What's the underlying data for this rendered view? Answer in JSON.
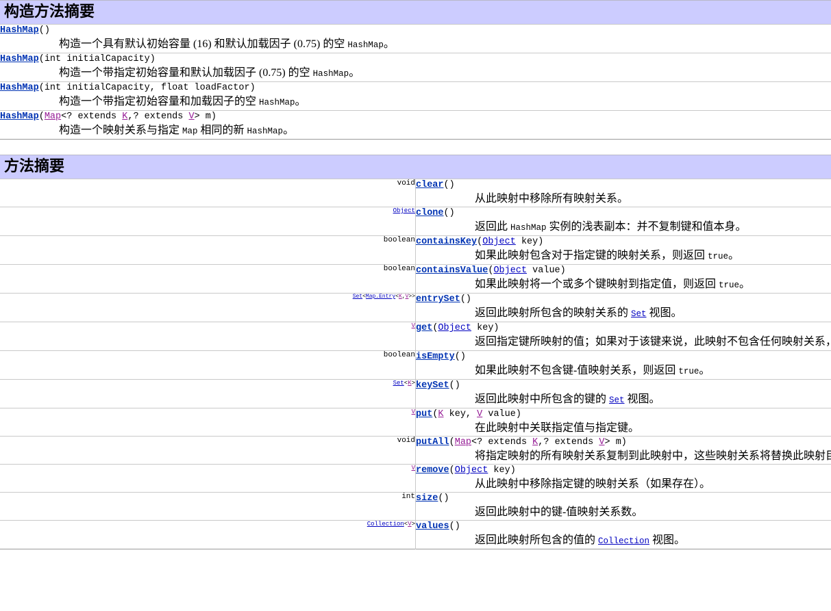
{
  "colors": {
    "banner_bg": "#CCCCFF",
    "link_blue": "#0000C0",
    "link_purple": "#951B95",
    "method_name": "#0033B3",
    "border_gray": "#C9C9C9",
    "text": "#000000"
  },
  "constructor_section": {
    "title": "构造方法摘要",
    "rows": [
      {
        "name": "HashMap",
        "signature_parts": [
          {
            "text": "HashMap",
            "kind": "method-link"
          },
          {
            "text": "()",
            "kind": "plain"
          }
        ],
        "signature_text": "HashMap()",
        "description_parts": [
          {
            "text": "构造一个具有默认初始容量 (16) 和默认加载因子 (0.75) 的空 ",
            "kind": "text"
          },
          {
            "text": "HashMap",
            "kind": "code"
          },
          {
            "text": "。",
            "kind": "text"
          }
        ],
        "description_text": "构造一个具有默认初始容量 (16) 和默认加载因子 (0.75) 的空 HashMap。"
      },
      {
        "name": "HashMap(int initialCapacity)",
        "signature_parts": [
          {
            "text": "HashMap",
            "kind": "method-link"
          },
          {
            "text": "(int initialCapacity)",
            "kind": "plain"
          }
        ],
        "signature_text": "HashMap(int initialCapacity)",
        "description_parts": [
          {
            "text": "构造一个带指定初始容量和默认加载因子 (0.75) 的空 ",
            "kind": "text"
          },
          {
            "text": "HashMap",
            "kind": "code"
          },
          {
            "text": "。",
            "kind": "text"
          }
        ],
        "description_text": "构造一个带指定初始容量和默认加载因子 (0.75) 的空 HashMap。"
      },
      {
        "name": "HashMap(int initialCapacity, float loadFactor)",
        "signature_parts": [
          {
            "text": "HashMap",
            "kind": "method-link"
          },
          {
            "text": "(int initialCapacity, float loadFactor)",
            "kind": "plain"
          }
        ],
        "signature_text": "HashMap(int initialCapacity, float loadFactor)",
        "description_parts": [
          {
            "text": "构造一个带指定初始容量和加载因子的空 ",
            "kind": "text"
          },
          {
            "text": "HashMap",
            "kind": "code"
          },
          {
            "text": "。",
            "kind": "text"
          }
        ],
        "description_text": "构造一个带指定初始容量和加载因子的空 HashMap。"
      },
      {
        "name": "HashMap(Map<? extends K,? extends V> m)",
        "signature_parts": [
          {
            "text": "HashMap",
            "kind": "method-link"
          },
          {
            "text": "(",
            "kind": "plain"
          },
          {
            "text": "Map",
            "kind": "type-link-purple"
          },
          {
            "text": "<? extends ",
            "kind": "plain"
          },
          {
            "text": "K",
            "kind": "type-link-purple"
          },
          {
            "text": ",? extends ",
            "kind": "plain"
          },
          {
            "text": "V",
            "kind": "type-link-purple"
          },
          {
            "text": "> m)",
            "kind": "plain"
          }
        ],
        "signature_text": "HashMap(Map<? extends K,? extends V> m)",
        "description_parts": [
          {
            "text": "构造一个映射关系与指定 ",
            "kind": "text"
          },
          {
            "text": "Map",
            "kind": "code"
          },
          {
            "text": " 相同的新 ",
            "kind": "text"
          },
          {
            "text": "HashMap",
            "kind": "code"
          },
          {
            "text": "。",
            "kind": "text"
          }
        ],
        "description_text": "构造一个映射关系与指定 Map 相同的新 HashMap。"
      }
    ]
  },
  "method_section": {
    "title": "方法摘要",
    "rows": [
      {
        "return_type_text": "void",
        "return_type_parts": [
          {
            "text": "void",
            "kind": "plain"
          }
        ],
        "return_size": "normal",
        "name": "clear",
        "signature_parts": [
          {
            "text": "clear",
            "kind": "method-link"
          },
          {
            "text": "()",
            "kind": "plain"
          }
        ],
        "signature_text": "clear()",
        "description_parts": [
          {
            "text": "从此映射中移除所有映射关系。",
            "kind": "text"
          }
        ],
        "description_text": "从此映射中移除所有映射关系。"
      },
      {
        "return_type_text": "Object",
        "return_type_parts": [
          {
            "text": "Object",
            "kind": "type-link"
          }
        ],
        "return_size": "tiny",
        "name": "clone",
        "signature_parts": [
          {
            "text": "clone",
            "kind": "method-link"
          },
          {
            "text": "()",
            "kind": "plain"
          }
        ],
        "signature_text": "clone()",
        "description_parts": [
          {
            "text": "返回此 ",
            "kind": "text"
          },
          {
            "text": "HashMap",
            "kind": "code"
          },
          {
            "text": " 实例的浅表副本：并不复制键和值本身。",
            "kind": "text"
          }
        ],
        "description_text": "返回此 HashMap 实例的浅表副本：并不复制键和值本身。"
      },
      {
        "return_type_text": "boolean",
        "return_type_parts": [
          {
            "text": "boolean",
            "kind": "plain"
          }
        ],
        "return_size": "normal",
        "name": "containsKey",
        "signature_parts": [
          {
            "text": "containsKey",
            "kind": "method-link"
          },
          {
            "text": "(",
            "kind": "plain"
          },
          {
            "text": "Object",
            "kind": "type-link"
          },
          {
            "text": " key)",
            "kind": "plain"
          }
        ],
        "signature_text": "containsKey(Object key)",
        "description_parts": [
          {
            "text": "如果此映射包含对于指定键的映射关系，则返回 ",
            "kind": "text"
          },
          {
            "text": "true",
            "kind": "code"
          },
          {
            "text": "。",
            "kind": "text"
          }
        ],
        "description_text": "如果此映射包含对于指定键的映射关系，则返回 true。"
      },
      {
        "return_type_text": "boolean",
        "return_type_parts": [
          {
            "text": "boolean",
            "kind": "plain"
          }
        ],
        "return_size": "normal",
        "name": "containsValue",
        "signature_parts": [
          {
            "text": "containsValue",
            "kind": "method-link"
          },
          {
            "text": "(",
            "kind": "plain"
          },
          {
            "text": "Object",
            "kind": "type-link"
          },
          {
            "text": " value)",
            "kind": "plain"
          }
        ],
        "signature_text": "containsValue(Object value)",
        "description_parts": [
          {
            "text": "如果此映射将一个或多个键映射到指定值，则返回 ",
            "kind": "text"
          },
          {
            "text": "true",
            "kind": "code"
          },
          {
            "text": "。",
            "kind": "text"
          }
        ],
        "description_text": "如果此映射将一个或多个键映射到指定值，则返回 true。"
      },
      {
        "return_type_text": "Set<Map.Entry<K,V>>",
        "return_type_parts": [
          {
            "text": "Set",
            "kind": "type-link"
          },
          {
            "text": "<",
            "kind": "plain"
          },
          {
            "text": "Map.Entry",
            "kind": "type-link"
          },
          {
            "text": "<",
            "kind": "plain"
          },
          {
            "text": "K",
            "kind": "type-link-purple"
          },
          {
            "text": ",",
            "kind": "plain"
          },
          {
            "text": "V",
            "kind": "type-link-purple"
          },
          {
            "text": ">>",
            "kind": "plain"
          }
        ],
        "return_size": "xtiny",
        "name": "entrySet",
        "signature_parts": [
          {
            "text": "entrySet",
            "kind": "method-link"
          },
          {
            "text": "()",
            "kind": "plain"
          }
        ],
        "signature_text": "entrySet()",
        "description_parts": [
          {
            "text": "返回此映射所包含的映射关系的 ",
            "kind": "text"
          },
          {
            "text": "Set",
            "kind": "code-link"
          },
          {
            "text": " 视图。",
            "kind": "text"
          }
        ],
        "description_text": "返回此映射所包含的映射关系的 Set 视图。"
      },
      {
        "return_type_text": "V",
        "return_type_parts": [
          {
            "text": "V",
            "kind": "type-link-purple"
          }
        ],
        "return_size": "tiny",
        "name": "get",
        "signature_parts": [
          {
            "text": "get",
            "kind": "method-link"
          },
          {
            "text": "(",
            "kind": "plain"
          },
          {
            "text": "Object",
            "kind": "type-link"
          },
          {
            "text": " key)",
            "kind": "plain"
          }
        ],
        "signature_text": "get(Object key)",
        "description_parts": [
          {
            "text": "返回指定键所映射的值；如果对于该键来说，此映射不包含任何映射关系，则返回 ",
            "kind": "text"
          },
          {
            "text": "null",
            "kind": "code"
          },
          {
            "text": "。",
            "kind": "text"
          }
        ],
        "description_text": "返回指定键所映射的值；如果对于该键来说，此映射不包含任何映射关系，则返回 null。"
      },
      {
        "return_type_text": "boolean",
        "return_type_parts": [
          {
            "text": "boolean",
            "kind": "plain"
          }
        ],
        "return_size": "normal",
        "name": "isEmpty",
        "signature_parts": [
          {
            "text": "isEmpty",
            "kind": "method-link"
          },
          {
            "text": "()",
            "kind": "plain"
          }
        ],
        "signature_text": "isEmpty()",
        "description_parts": [
          {
            "text": "如果此映射不包含键-值映射关系，则返回 ",
            "kind": "text"
          },
          {
            "text": "true",
            "kind": "code"
          },
          {
            "text": "。",
            "kind": "text"
          }
        ],
        "description_text": "如果此映射不包含键-值映射关系，则返回 true。"
      },
      {
        "return_type_text": "Set<K>",
        "return_type_parts": [
          {
            "text": "Set",
            "kind": "type-link"
          },
          {
            "text": "<",
            "kind": "plain"
          },
          {
            "text": "K",
            "kind": "type-link-purple"
          },
          {
            "text": ">",
            "kind": "plain"
          }
        ],
        "return_size": "tiny",
        "name": "keySet",
        "signature_parts": [
          {
            "text": "keySet",
            "kind": "method-link"
          },
          {
            "text": "()",
            "kind": "plain"
          }
        ],
        "signature_text": "keySet()",
        "description_parts": [
          {
            "text": "返回此映射中所包含的键的 ",
            "kind": "text"
          },
          {
            "text": "Set",
            "kind": "code-link"
          },
          {
            "text": " 视图。",
            "kind": "text"
          }
        ],
        "description_text": "返回此映射中所包含的键的 Set 视图。"
      },
      {
        "return_type_text": "V",
        "return_type_parts": [
          {
            "text": "V",
            "kind": "type-link-purple"
          }
        ],
        "return_size": "tiny",
        "name": "put",
        "signature_parts": [
          {
            "text": "put",
            "kind": "method-link"
          },
          {
            "text": "(",
            "kind": "plain"
          },
          {
            "text": "K",
            "kind": "type-link-purple"
          },
          {
            "text": " key, ",
            "kind": "plain"
          },
          {
            "text": "V",
            "kind": "type-link-purple"
          },
          {
            "text": " value)",
            "kind": "plain"
          }
        ],
        "signature_text": "put(K key, V value)",
        "description_parts": [
          {
            "text": "在此映射中关联指定值与指定键。",
            "kind": "text"
          }
        ],
        "description_text": "在此映射中关联指定值与指定键。"
      },
      {
        "return_type_text": "void",
        "return_type_parts": [
          {
            "text": "void",
            "kind": "plain"
          }
        ],
        "return_size": "normal",
        "name": "putAll",
        "signature_parts": [
          {
            "text": "putAll",
            "kind": "method-link"
          },
          {
            "text": "(",
            "kind": "plain"
          },
          {
            "text": "Map",
            "kind": "type-link-purple"
          },
          {
            "text": "<? extends ",
            "kind": "plain"
          },
          {
            "text": "K",
            "kind": "type-link-purple"
          },
          {
            "text": ",? extends ",
            "kind": "plain"
          },
          {
            "text": "V",
            "kind": "type-link-purple"
          },
          {
            "text": "> m)",
            "kind": "plain"
          }
        ],
        "signature_text": "putAll(Map<? extends K,? extends V> m)",
        "description_parts": [
          {
            "text": "将指定映射的所有映射关系复制到此映射中，这些映射关系将替换此映射目前针对指定映射中所有键的所有映射关系。",
            "kind": "text"
          }
        ],
        "description_text": "将指定映射的所有映射关系复制到此映射中，这些映射关系将替换此映射目前针对指定映射中所有键的所有映射关系。"
      },
      {
        "return_type_text": "V",
        "return_type_parts": [
          {
            "text": "V",
            "kind": "type-link-purple"
          }
        ],
        "return_size": "tiny",
        "name": "remove",
        "signature_parts": [
          {
            "text": "remove",
            "kind": "method-link"
          },
          {
            "text": "(",
            "kind": "plain"
          },
          {
            "text": "Object",
            "kind": "type-link"
          },
          {
            "text": " key)",
            "kind": "plain"
          }
        ],
        "signature_text": "remove(Object key)",
        "description_parts": [
          {
            "text": "从此映射中移除指定键的映射关系（如果存在）。",
            "kind": "text"
          }
        ],
        "description_text": "从此映射中移除指定键的映射关系（如果存在）。"
      },
      {
        "return_type_text": "int",
        "return_type_parts": [
          {
            "text": "int",
            "kind": "plain"
          }
        ],
        "return_size": "normal",
        "name": "size",
        "signature_parts": [
          {
            "text": "size",
            "kind": "method-link"
          },
          {
            "text": "()",
            "kind": "plain"
          }
        ],
        "signature_text": "size()",
        "description_parts": [
          {
            "text": "返回此映射中的键-值映射关系数。",
            "kind": "text"
          }
        ],
        "description_text": "返回此映射中的键-值映射关系数。"
      },
      {
        "return_type_text": "Collection<V>",
        "return_type_parts": [
          {
            "text": "Collection",
            "kind": "type-link"
          },
          {
            "text": "<",
            "kind": "plain"
          },
          {
            "text": "V",
            "kind": "type-link-purple"
          },
          {
            "text": ">",
            "kind": "plain"
          }
        ],
        "return_size": "tiny",
        "name": "values",
        "signature_parts": [
          {
            "text": "values",
            "kind": "method-link"
          },
          {
            "text": "()",
            "kind": "plain"
          }
        ],
        "signature_text": "values()",
        "description_parts": [
          {
            "text": "返回此映射所包含的值的 ",
            "kind": "text"
          },
          {
            "text": "Collection",
            "kind": "code-link"
          },
          {
            "text": " 视图。",
            "kind": "text"
          }
        ],
        "description_text": "返回此映射所包含的值的 Collection 视图。"
      }
    ]
  }
}
